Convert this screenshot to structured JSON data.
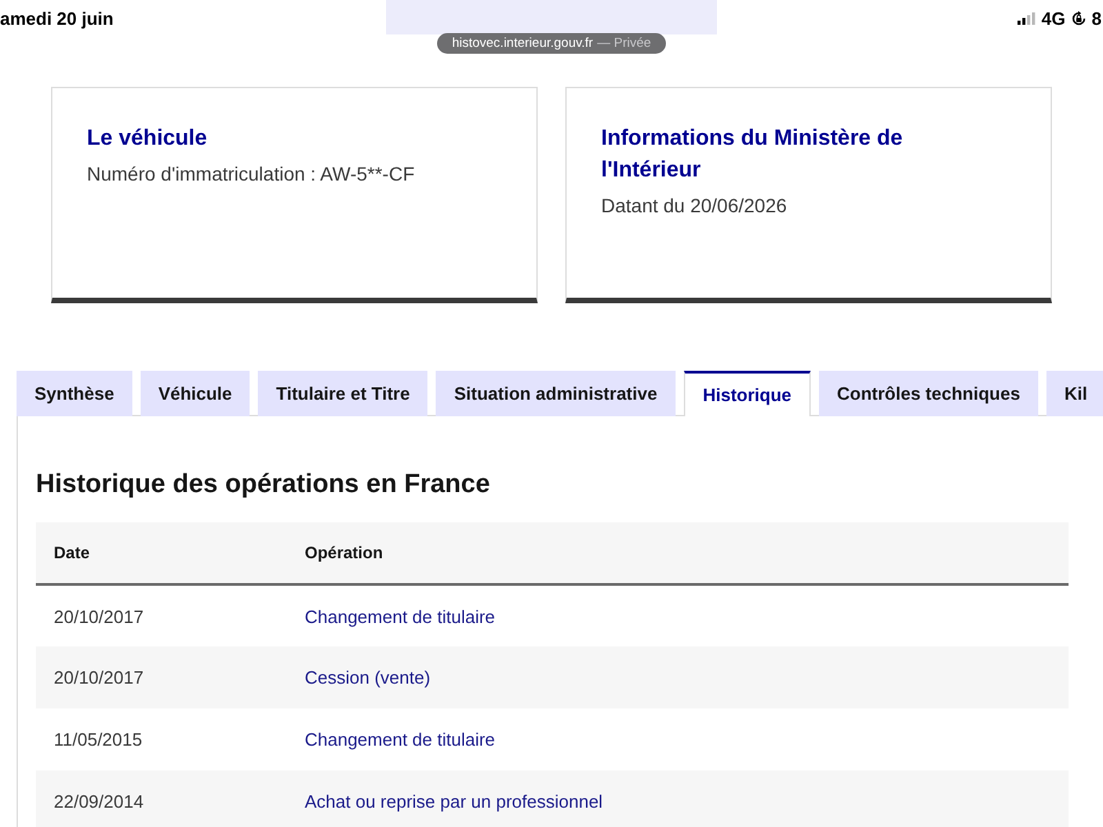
{
  "status_bar": {
    "date": "amedi 20 juin",
    "network": "4G",
    "battery": "8"
  },
  "address_bar": {
    "url": "histovec.interieur.gouv.fr",
    "mode": "— Privée"
  },
  "cards": [
    {
      "title": "Le véhicule",
      "text": "Numéro d'immatriculation : AW-5**-CF"
    },
    {
      "title": "Informations du Ministère de l'Intérieur",
      "text": "Datant du 20/06/2026"
    }
  ],
  "tabs": [
    {
      "label": "Synthèse",
      "selected": false
    },
    {
      "label": "Véhicule",
      "selected": false
    },
    {
      "label": "Titulaire et Titre",
      "selected": false
    },
    {
      "label": "Situation administrative",
      "selected": false
    },
    {
      "label": "Historique",
      "selected": true
    },
    {
      "label": "Contrôles techniques",
      "selected": false
    },
    {
      "label": "Kil",
      "selected": false
    }
  ],
  "section": {
    "title": "Historique des opérations en France",
    "table": {
      "columns": [
        "Date",
        "Opération"
      ],
      "rows": [
        {
          "date": "20/10/2017",
          "operation": "Changement de titulaire"
        },
        {
          "date": "20/10/2017",
          "operation": "Cession (vente)"
        },
        {
          "date": "11/05/2015",
          "operation": "Changement de titulaire"
        },
        {
          "date": "22/09/2014",
          "operation": "Achat ou reprise par un professionnel"
        }
      ]
    }
  }
}
